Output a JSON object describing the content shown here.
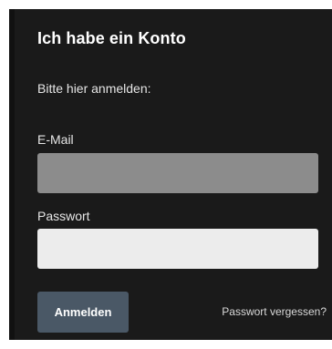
{
  "login": {
    "heading": "Ich habe ein Konto",
    "subtitle": "Bitte hier anmelden:",
    "email_label": "E-Mail",
    "email_value": "",
    "password_label": "Passwort",
    "password_value": "",
    "submit_label": "Anmelden",
    "forgot_label": "Passwort vergessen?"
  },
  "colors": {
    "panel_background": "#1a1a1a",
    "email_field": "#8c8c8c",
    "password_field": "#ececec",
    "button": "#4a5866",
    "text": "#ffffff"
  }
}
